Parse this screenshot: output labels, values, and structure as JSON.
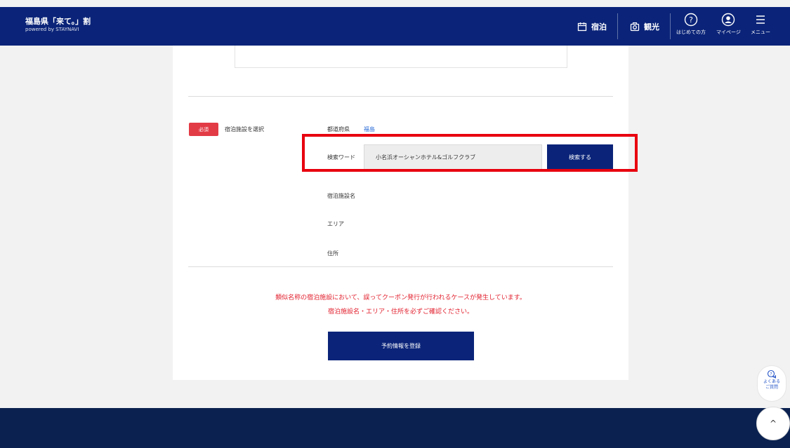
{
  "header": {
    "brand_title": "福島県「来て。」割",
    "brand_sub": "powered by STAYNAVI",
    "nav_stay": "宿泊",
    "nav_sightseeing": "観光",
    "nav_first_time": "はじめての方",
    "nav_mypage": "マイページ",
    "nav_menu": "メニュー"
  },
  "form": {
    "required_badge": "必須",
    "select_facility_label": "宿泊施設を選択",
    "prefecture_label": "都道府県",
    "prefecture_value": "福島",
    "search_word_label": "検索ワード",
    "search_word_value": "小名浜オーシャンホテル&ゴルフクラブ",
    "search_button": "検索する",
    "facility_name_label": "宿泊施設名",
    "area_label": "エリア",
    "address_label": "住所"
  },
  "warning": {
    "line1": "類似名称の宿泊施設において、誤ってクーポン発行が行われるケースが発生しています。",
    "line2": "宿泊施設名・エリア・住所を必ずご確認ください。"
  },
  "register_button": "予約情報を登録",
  "faq": {
    "line1": "よくある",
    "line2": "ご質問"
  },
  "to_top": "^",
  "colors": {
    "primary": "#0b2479",
    "required": "#e23b46",
    "warning": "#e2202e",
    "highlight": "#e8000f",
    "link": "#2f6fd8"
  }
}
